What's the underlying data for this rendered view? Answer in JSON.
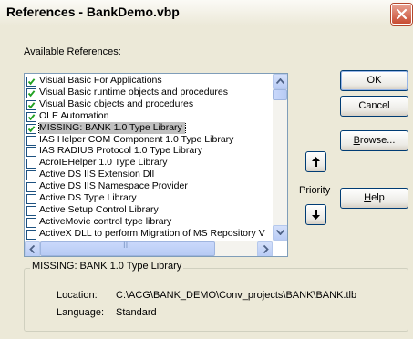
{
  "window": {
    "title": "References - BankDemo.vbp"
  },
  "available_refs": {
    "label_first": "A",
    "label_rest": "vailable References:",
    "items": [
      {
        "label": "Visual Basic For Applications",
        "checked": true
      },
      {
        "label": "Visual Basic runtime objects and procedures",
        "checked": true
      },
      {
        "label": "Visual Basic objects and procedures",
        "checked": true
      },
      {
        "label": "OLE Automation",
        "checked": true
      },
      {
        "label": "MISSING: BANK 1.0 Type Library",
        "checked": true,
        "selected": true
      },
      {
        "label": "IAS Helper COM Component 1.0 Type Library",
        "checked": false
      },
      {
        "label": "IAS RADIUS Protocol 1.0 Type Library",
        "checked": false
      },
      {
        "label": "AcroIEHelper 1.0 Type Library",
        "checked": false
      },
      {
        "label": "Active DS IIS Extension Dll",
        "checked": false
      },
      {
        "label": "Active DS IIS Namespace Provider",
        "checked": false
      },
      {
        "label": "Active DS Type Library",
        "checked": false
      },
      {
        "label": "Active Setup Control Library",
        "checked": false
      },
      {
        "label": "ActiveMovie control type library",
        "checked": false
      },
      {
        "label": "ActiveX DLL to perform Migration of MS Repository V",
        "checked": false
      }
    ],
    "hscroll_grip": "III"
  },
  "buttons": {
    "ok": "OK",
    "cancel": "Cancel",
    "browse_first": "B",
    "browse_rest": "rowse...",
    "help_first": "H",
    "help_rest": "elp"
  },
  "priority": {
    "label": "Priority"
  },
  "details": {
    "group_title": "MISSING: BANK 1.0 Type Library",
    "location_label": "Location:",
    "location_value": "C:\\ACG\\BANK_DEMO\\Conv_projects\\BANK\\BANK.tlb",
    "language_label": "Language:",
    "language_value": "Standard"
  },
  "colors": {
    "dialog_bg": "#ece9d8",
    "selection_bg": "#c0c0c0",
    "close_button": "#c84c32"
  },
  "icons": [
    "close-icon",
    "checkmark-icon",
    "up-arrow-icon",
    "down-arrow-icon",
    "scroll-up-icon",
    "scroll-down-icon",
    "scroll-left-icon",
    "scroll-right-icon"
  ]
}
